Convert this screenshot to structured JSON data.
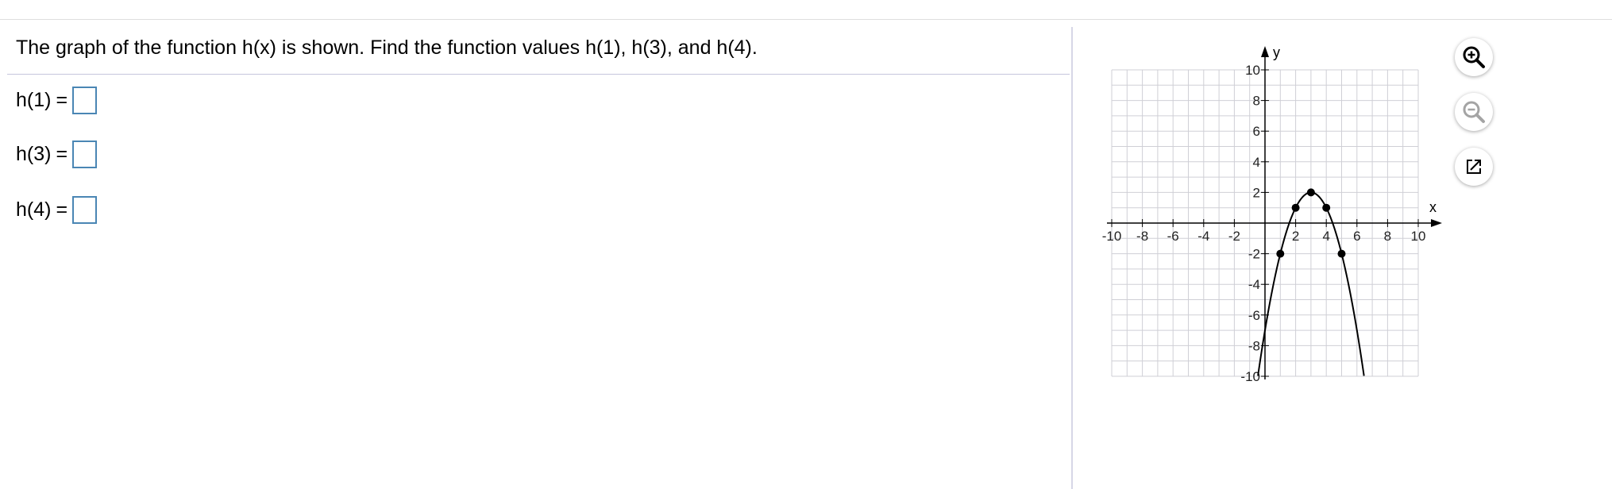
{
  "question": {
    "text": "The graph of the function h(x) is shown. Find the function values h(1), h(3), and h(4)."
  },
  "answers": [
    {
      "label": "h(1)",
      "equals": "=",
      "value": ""
    },
    {
      "label": "h(3)",
      "equals": "=",
      "value": ""
    },
    {
      "label": "h(4)",
      "equals": "=",
      "value": ""
    }
  ],
  "graph": {
    "x_axis_label": "x",
    "y_axis_label": "y",
    "x_tick_labels": [
      "-10",
      "-8",
      "-6",
      "-4",
      "-2",
      "2",
      "4",
      "6",
      "8",
      "10"
    ],
    "y_tick_labels": [
      "10",
      "8",
      "6",
      "4",
      "2",
      "-2",
      "-4",
      "-6",
      "-8",
      "-10"
    ],
    "xlim": [
      -10,
      10
    ],
    "ylim": [
      -10,
      10
    ],
    "grid_step": 1,
    "marked_points": [
      {
        "x": 1,
        "y": -2
      },
      {
        "x": 2,
        "y": 1
      },
      {
        "x": 3,
        "y": 2
      },
      {
        "x": 4,
        "y": 1
      },
      {
        "x": 5,
        "y": -2
      }
    ],
    "curve": {
      "type": "parabola",
      "vertex": [
        3,
        2
      ],
      "a": -1
    }
  },
  "tools": [
    {
      "name": "zoom-in-button",
      "icon": "zoom-in-icon"
    },
    {
      "name": "zoom-out-button",
      "icon": "zoom-out-icon"
    },
    {
      "name": "popout-button",
      "icon": "external-link-icon"
    }
  ]
}
